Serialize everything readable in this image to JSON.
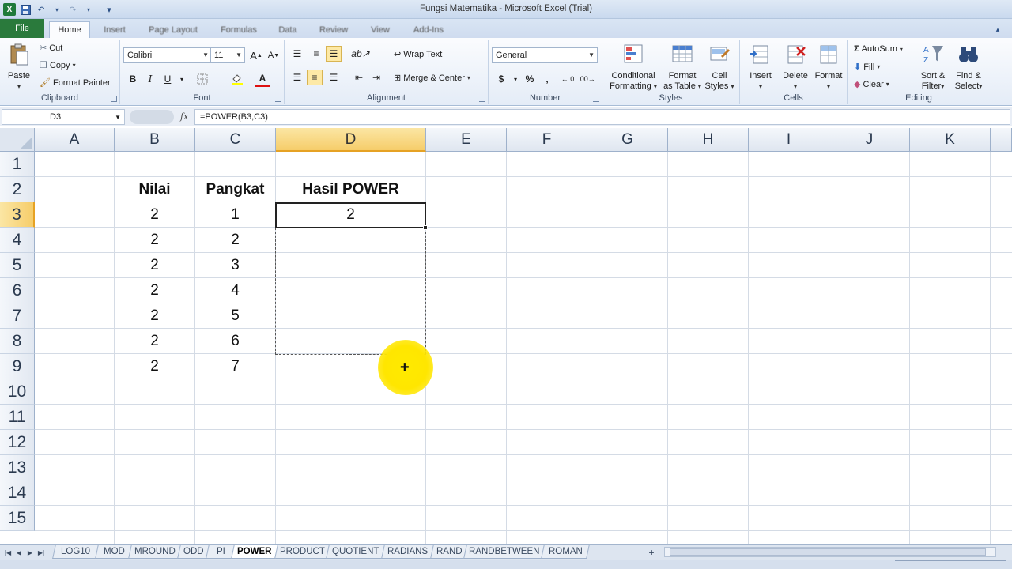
{
  "window": {
    "title": "Fungsi Matematika - Microsoft Excel (Trial)"
  },
  "ribbon_tabs": [
    {
      "label": "File"
    },
    {
      "label": "Home"
    },
    {
      "label": "Insert"
    },
    {
      "label": "Page Layout"
    },
    {
      "label": "Formulas"
    },
    {
      "label": "Data"
    },
    {
      "label": "Review"
    },
    {
      "label": "View"
    },
    {
      "label": "Add-Ins"
    }
  ],
  "clipboard": {
    "paste": "Paste",
    "cut": "Cut",
    "copy": "Copy",
    "format_painter": "Format Painter",
    "label": "Clipboard"
  },
  "font": {
    "name": "Calibri",
    "size": "11",
    "bold": "B",
    "italic": "I",
    "underline": "U",
    "label": "Font"
  },
  "alignment": {
    "wrap": "Wrap Text",
    "merge": "Merge & Center",
    "label": "Alignment"
  },
  "number": {
    "format": "General",
    "currency": "$",
    "percent": "%",
    "comma": ",",
    "label": "Number"
  },
  "styles": {
    "conditional": [
      "Conditional",
      "Formatting"
    ],
    "format_table": [
      "Format",
      "as Table"
    ],
    "cell_styles": [
      "Cell",
      "Styles"
    ],
    "label": "Styles"
  },
  "cells": {
    "insert": "Insert",
    "delete": "Delete",
    "format": "Format",
    "label": "Cells"
  },
  "editing": {
    "autosum": "AutoSum",
    "fill": "Fill",
    "clear": "Clear",
    "sort": [
      "Sort &",
      "Filter"
    ],
    "find": [
      "Find &",
      "Select"
    ],
    "label": "Editing"
  },
  "formula_bar": {
    "name_box": "D3",
    "fx": "fx",
    "formula": "=POWER(B3,C3)"
  },
  "columns": [
    "A",
    "B",
    "C",
    "D",
    "E",
    "F",
    "G",
    "H",
    "I",
    "J",
    "K"
  ],
  "rows": [
    "1",
    "2",
    "3",
    "4",
    "5",
    "6",
    "7",
    "8",
    "9",
    "10",
    "11",
    "12",
    "13",
    "14",
    "15"
  ],
  "selected_cell": "D3",
  "table": {
    "headers": [
      "Nilai",
      "Pangkat",
      "Hasil POWER"
    ],
    "rows": [
      [
        "2",
        "1",
        "2"
      ],
      [
        "2",
        "2",
        ""
      ],
      [
        "2",
        "3",
        ""
      ],
      [
        "2",
        "4",
        ""
      ],
      [
        "2",
        "5",
        ""
      ],
      [
        "2",
        "6",
        ""
      ],
      [
        "2",
        "7",
        ""
      ]
    ]
  },
  "cursor_icon": "plus-crosshair-icon",
  "sheet_tabs": [
    "LOG10",
    "MOD",
    "MROUND",
    "ODD",
    "PI",
    "POWER",
    "PRODUCT",
    "QUOTIENT",
    "RADIANS",
    "RAND",
    "RANDBETWEEN",
    "ROMAN"
  ],
  "active_sheet": "POWER",
  "colors": {
    "file_tab": "#2a7a3c",
    "selection_header": "#f6cd6a",
    "cursor_highlight": "#ffe600"
  }
}
